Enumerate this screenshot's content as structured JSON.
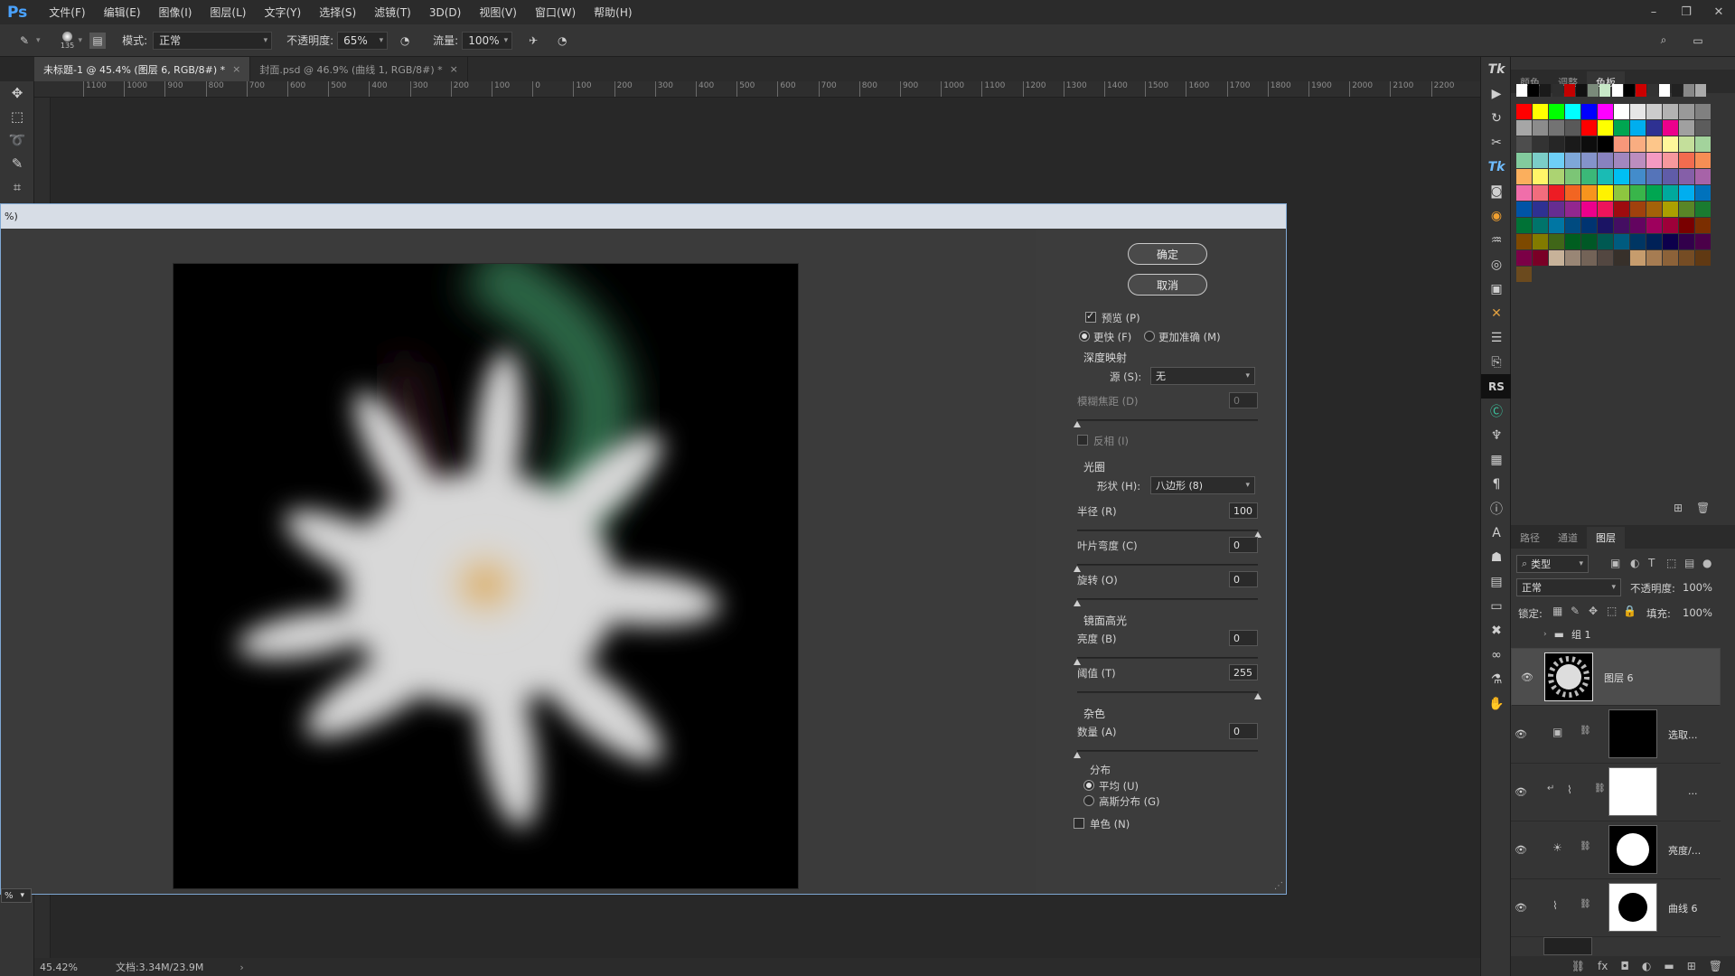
{
  "app": {
    "logo": "Ps",
    "menus": [
      "文件(F)",
      "编辑(E)",
      "图像(I)",
      "图层(L)",
      "文字(Y)",
      "选择(S)",
      "滤镜(T)",
      "3D(D)",
      "视图(V)",
      "窗口(W)",
      "帮助(H)"
    ]
  },
  "options": {
    "brush_size": "135",
    "mode_label": "模式:",
    "mode_value": "正常",
    "opacity_label": "不透明度:",
    "opacity_value": "65%",
    "flow_label": "流量:",
    "flow_value": "100%"
  },
  "tabs": [
    {
      "label": "未标题-1 @ 45.4% (图层 6, RGB/8#) *",
      "close": "×"
    },
    {
      "label": "封面.psd @ 46.9% (曲线 1, RGB/8#) *",
      "close": "×"
    }
  ],
  "ruler_h": [
    "1100",
    "1000",
    "900",
    "800",
    "700",
    "600",
    "500",
    "400",
    "300",
    "200",
    "100",
    "0",
    "100",
    "200",
    "300",
    "400",
    "500",
    "600",
    "700",
    "800",
    "900",
    "1000",
    "1100",
    "1200",
    "1300",
    "1400",
    "1500",
    "1600",
    "1700",
    "1800",
    "1900",
    "2000",
    "2100",
    "2200"
  ],
  "dialog": {
    "title": "%)",
    "zoom": "%",
    "ok": "确定",
    "cancel": "取消",
    "preview": "预览 (P)",
    "faster": "更快 (F)",
    "more_accurate": "更加准确 (M)",
    "depth_map": "深度映射",
    "source_label": "源 (S):",
    "source_value": "无",
    "blur_focal": "模糊焦距 (D)",
    "blur_focal_value": "0",
    "invert": "反相 (I)",
    "iris": "光圈",
    "shape_label": "形状 (H):",
    "shape_value": "八边形 (8)",
    "radius_label": "半径 (R)",
    "radius_value": "100",
    "blade_label": "叶片弯度 (C)",
    "blade_value": "0",
    "rotation_label": "旋转 (O)",
    "rotation_value": "0",
    "specular": "镜面高光",
    "brightness_label": "亮度 (B)",
    "brightness_value": "0",
    "threshold_label": "阈值 (T)",
    "threshold_value": "255",
    "noise": "杂色",
    "amount_label": "数量 (A)",
    "amount_value": "0",
    "distribution": "分布",
    "uniform": "平均 (U)",
    "gaussian": "高斯分布 (G)",
    "monochromatic": "单色 (N)",
    "sliders": {
      "blur_focal": 0,
      "radius": 1.0,
      "blade": 0,
      "rotation": 0,
      "brightness": 0,
      "threshold": 1.0,
      "amount": 0
    }
  },
  "status": {
    "zoom": "45.42%",
    "doc": "文档:3.34M/23.9M"
  },
  "panels": {
    "top_tabs": [
      "颜色",
      "调整",
      "色板"
    ],
    "bottom_tabs": [
      "路径",
      "通道",
      "图层"
    ],
    "filter_kind": "类型",
    "blend_mode": "正常",
    "opacity_label": "不透明度:",
    "opacity_value": "100%",
    "lock_label": "锁定:",
    "fill_label": "填充:",
    "fill_value": "100%",
    "layers": [
      {
        "name": "组 1"
      },
      {
        "name": "图层 6"
      },
      {
        "name": "选取..."
      },
      {
        "name": "..."
      },
      {
        "name": "亮度/..."
      },
      {
        "name": "曲线 6"
      }
    ]
  },
  "colors": {
    "swatches_row0": [
      "#ffffff",
      "#000000",
      "#1a1a1a",
      "#2e2e2e",
      "#c40000",
      "#111111",
      "#7a8a7a",
      "#c7e8c7",
      "#ffffff",
      "#000000",
      "#cc0000",
      "#333333",
      "#ffffff",
      "#222222",
      "#888888",
      "#aaaaaa"
    ],
    "swatches_grid": [
      [
        "#ff0000",
        "#ffff00",
        "#00ff00",
        "#00ffff",
        "#0000ff",
        "#ff00ff",
        "#ffffff",
        "#e6e6e6",
        "#cccccc",
        "#b3b3b3",
        "#999999",
        "#808080"
      ],
      [
        "#a6a6a6",
        "#8c8c8c",
        "#737373",
        "#595959",
        "#ff0000",
        "#ffff00",
        "#00a651",
        "#00aeef",
        "#2e3192",
        "#ec008c",
        "#a0a0a0",
        "#5c5c5c"
      ],
      [
        "#4d4d4d",
        "#333333",
        "#262626",
        "#1a1a1a",
        "#0d0d0d",
        "#000000",
        "#f7977a",
        "#f9ad81",
        "#fdc68a",
        "#fff79a",
        "#c4df9b",
        "#a3d39c"
      ],
      [
        "#82ca9d",
        "#7bcdc8",
        "#6ecff6",
        "#7ea7d8",
        "#8493ca",
        "#8882be",
        "#a187be",
        "#bc8dbf",
        "#f49ac2",
        "#f6989d",
        "#f26c4f",
        "#f68e55"
      ],
      [
        "#fbaf5d",
        "#fff568",
        "#acd372",
        "#7cc576",
        "#3bb878",
        "#1abbb4",
        "#00bff3",
        "#438ccb",
        "#5574b9",
        "#605ca8",
        "#855fa8",
        "#a763a8"
      ],
      [
        "#f06eaa",
        "#f26d7d",
        "#ed1c24",
        "#f26522",
        "#f7941d",
        "#fff200",
        "#8dc63f",
        "#39b54a",
        "#00a651",
        "#00a99d",
        "#00aeef",
        "#0072bc"
      ],
      [
        "#0054a6",
        "#2e3192",
        "#662d91",
        "#92278f",
        "#ec008c",
        "#ed145b",
        "#9e0b0f",
        "#a0410d",
        "#a36209",
        "#aba000",
        "#598527",
        "#1a7b30"
      ],
      [
        "#007236",
        "#00746b",
        "#0076a3",
        "#004b80",
        "#003471",
        "#1b1464",
        "#440e62",
        "#630460",
        "#9e005d",
        "#9e0039",
        "#790000",
        "#7b2e00"
      ],
      [
        "#7d4900",
        "#827b00",
        "#406618",
        "#005e20",
        "#005826",
        "#005952",
        "#005b7f",
        "#003663",
        "#002157",
        "#0d004c",
        "#32004b",
        "#4b0049"
      ],
      [
        "#7b0046",
        "#7a0026",
        "#c7b299",
        "#998675",
        "#736357",
        "#534741",
        "#37302a",
        "#c69c6d",
        "#a67c52",
        "#8c6239",
        "#754c24",
        "#603913"
      ],
      [
        "#6b4a1e"
      ]
    ]
  }
}
